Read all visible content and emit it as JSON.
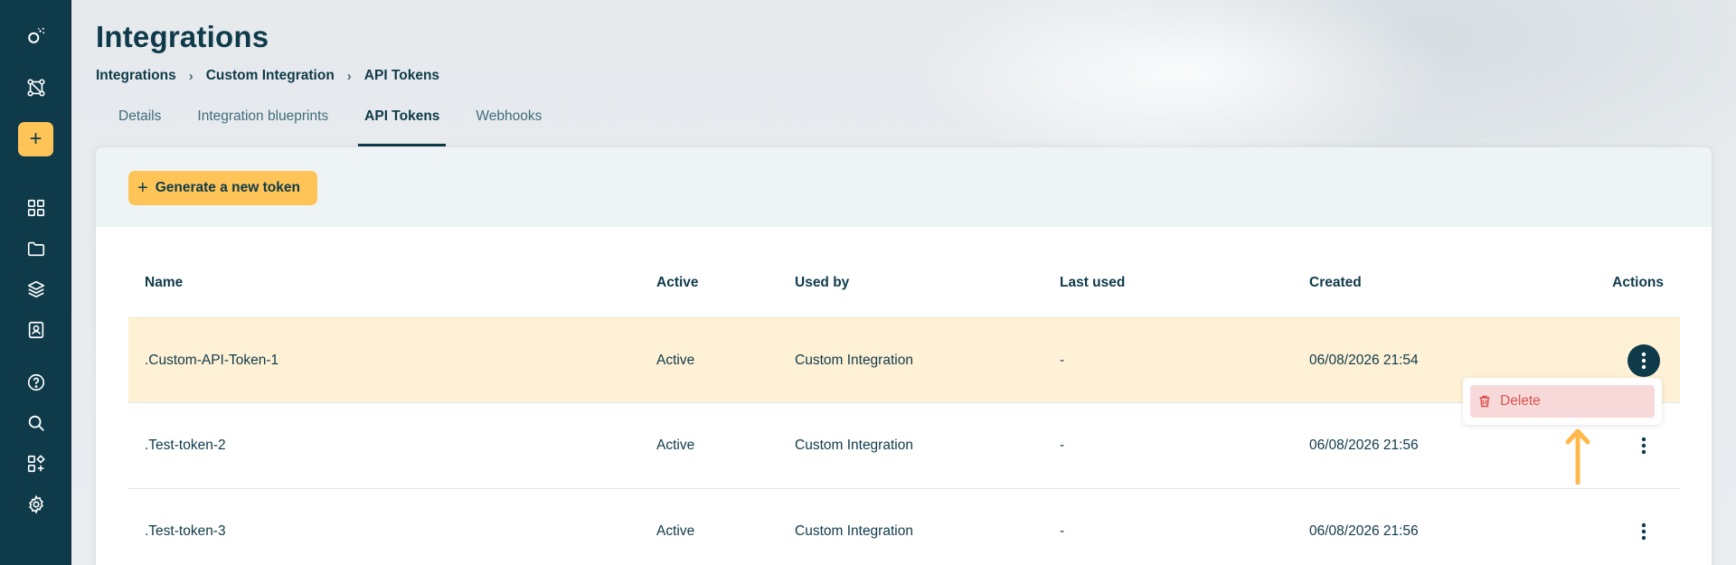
{
  "header": {
    "title": "Integrations"
  },
  "breadcrumb": [
    "Integrations",
    "Custom Integration",
    "API Tokens"
  ],
  "tabs": [
    {
      "label": "Details",
      "active": false
    },
    {
      "label": "Integration blueprints",
      "active": false
    },
    {
      "label": "API Tokens",
      "active": true
    },
    {
      "label": "Webhooks",
      "active": false
    }
  ],
  "sidebar": {
    "icons": [
      "logo-icon",
      "integrations-icon",
      "add-icon",
      "dashboard-icon",
      "folder-icon",
      "layers-icon",
      "contacts-icon",
      "help-icon",
      "search-icon",
      "apps-icon",
      "settings-icon"
    ],
    "add_label": "+"
  },
  "toolbar": {
    "generate_label": "Generate a new token",
    "generate_plus": "+"
  },
  "table": {
    "columns": [
      "Name",
      "Active",
      "Used by",
      "Last used",
      "Created",
      "Actions"
    ],
    "rows": [
      {
        "name": ".Custom-API-Token-1",
        "active": "Active",
        "used_by": "Custom Integration",
        "last_used": "-",
        "created": "06/08/2026 21:54"
      },
      {
        "name": ".Test-token-2",
        "active": "Active",
        "used_by": "Custom Integration",
        "last_used": "-",
        "created": "06/08/2026 21:56"
      },
      {
        "name": ".Test-token-3",
        "active": "Active",
        "used_by": "Custom Integration",
        "last_used": "-",
        "created": "06/08/2026 21:56"
      }
    ]
  },
  "menu": {
    "delete_label": "Delete"
  },
  "colors": {
    "primary": "#0f3a4a",
    "accent": "#ffc457",
    "selected_row": "#fff1d6",
    "danger": "#d9534f",
    "danger_bg": "#f8d9d9"
  }
}
